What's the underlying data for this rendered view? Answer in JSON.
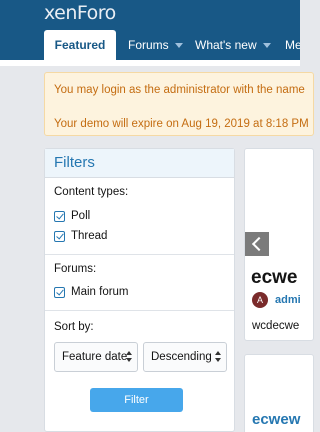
{
  "header": {
    "logo": "xenForo",
    "tabs": [
      {
        "label": "Featured"
      },
      {
        "label": "Forums"
      },
      {
        "label": "What's new"
      },
      {
        "label": "Me"
      }
    ]
  },
  "notice": {
    "line1": "You may login as the administrator with the name",
    "line2": "Your demo will expire on Aug 19, 2019 at 8:18 PM"
  },
  "filters": {
    "title": "Filters",
    "content_types_label": "Content types:",
    "content_types": [
      "Poll",
      "Thread"
    ],
    "forums_label": "Forums:",
    "forums": [
      "Main forum"
    ],
    "sort_label": "Sort by:",
    "sort_field": "Feature date",
    "sort_direction": "Descending",
    "button": "Filter"
  },
  "card": {
    "title": "ecwe",
    "avatar_letter": "A",
    "author": "admi",
    "text": "wcdecwe"
  },
  "card2": {
    "title": "ecwew"
  },
  "colors": {
    "header_bg": "#185886",
    "accent": "#2577b1",
    "notice_bg": "#fdf3de",
    "notice_text": "#c46d12",
    "button_bg": "#47a7eb"
  }
}
